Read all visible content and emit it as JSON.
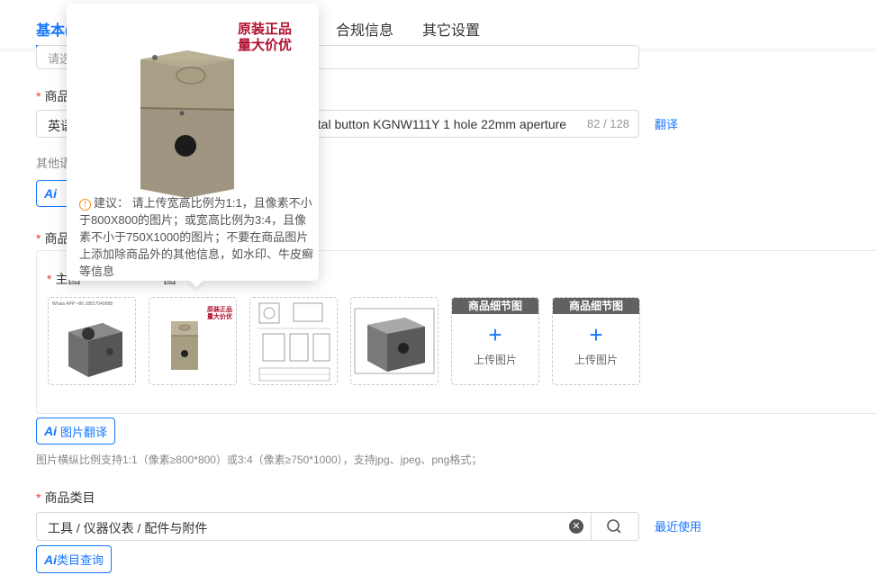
{
  "tabs": [
    {
      "label": "基本信息",
      "visible": "基本("
    },
    {
      "label": "合规信息"
    },
    {
      "label": "其它设置"
    }
  ],
  "top_input": {
    "placeholder": "请选"
  },
  "product_name": {
    "label": "商品",
    "prefix": "英语",
    "value": "etal button KGNW111Y 1 hole 22mm aperture",
    "count": "82 / 128",
    "translate_link": "翻译"
  },
  "other_lang": {
    "label": "其他语",
    "ai_btn": "A"
  },
  "product_images": {
    "label": "商品",
    "main_label": "主图",
    "main_label_tail": "图",
    "upload_slots": [
      {
        "header": "商品细节图",
        "plus": "+",
        "text": "上传图片"
      },
      {
        "header": "商品细节图",
        "plus": "+",
        "text": "上传图片"
      }
    ],
    "thumb1_caption": "Whats APP +86 18817040688",
    "thumb2_promo": "原装正品 量大价优",
    "ai_translate_btn": "图片翻译",
    "hint": "图片横纵比例支持1:1（像素≥800*800）或3:4（像素≥750*1000），支持jpg、jpeg、png格式；"
  },
  "category": {
    "label": "商品类目",
    "value": "工具 / 仪器仪表 / 配件与附件",
    "recent_link": "最近使用",
    "ai_btn": "类目查询"
  },
  "popover": {
    "promo_line1": "原装正品",
    "promo_line2": "量大价优",
    "advice": "建议： 请上传宽高比例为1:1，且像素不小于800X800的图片；或宽高比例为3:4，且像素不小于750X1000的图片；不要在商品图片上添加除商品外的其他信息，如水印、牛皮癣等信息"
  },
  "ai_mark": "Ai",
  "colors": {
    "accent": "#1677ff",
    "required": "#e53935",
    "promo": "#b0102f"
  }
}
